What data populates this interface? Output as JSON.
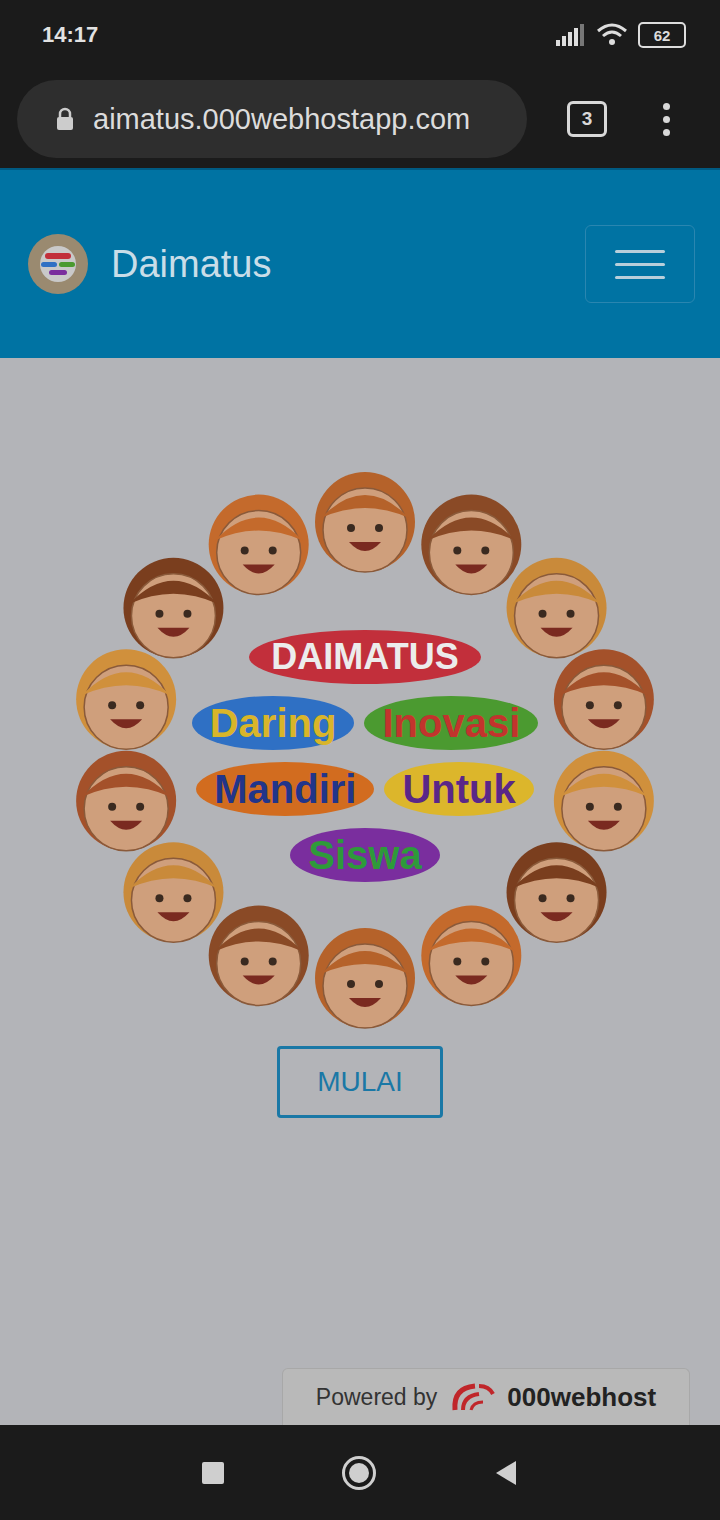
{
  "status_bar": {
    "time": "14:17",
    "battery": "62"
  },
  "browser": {
    "url": "aimatus.000webhostapp.com",
    "tab_count": "3"
  },
  "navbar": {
    "brand": "Daimatus"
  },
  "hero": {
    "rows": [
      [
        {
          "text": "DAIMATUS",
          "color": "#c22f3b"
        }
      ],
      [
        {
          "text": "Daring",
          "color": "#2f70c4"
        },
        {
          "text": "Inovasi",
          "color": "#4b9a30"
        }
      ],
      [
        {
          "text": "Mandiri",
          "color": "#d26c1f"
        },
        {
          "text": "Untuk",
          "color": "#dcb62b"
        }
      ],
      [
        {
          "text": "Siswa",
          "color": "#7a2e9e"
        }
      ]
    ]
  },
  "start_button": "MULAI",
  "badge": {
    "prefix": "Powered by",
    "brand": "000webhost"
  }
}
